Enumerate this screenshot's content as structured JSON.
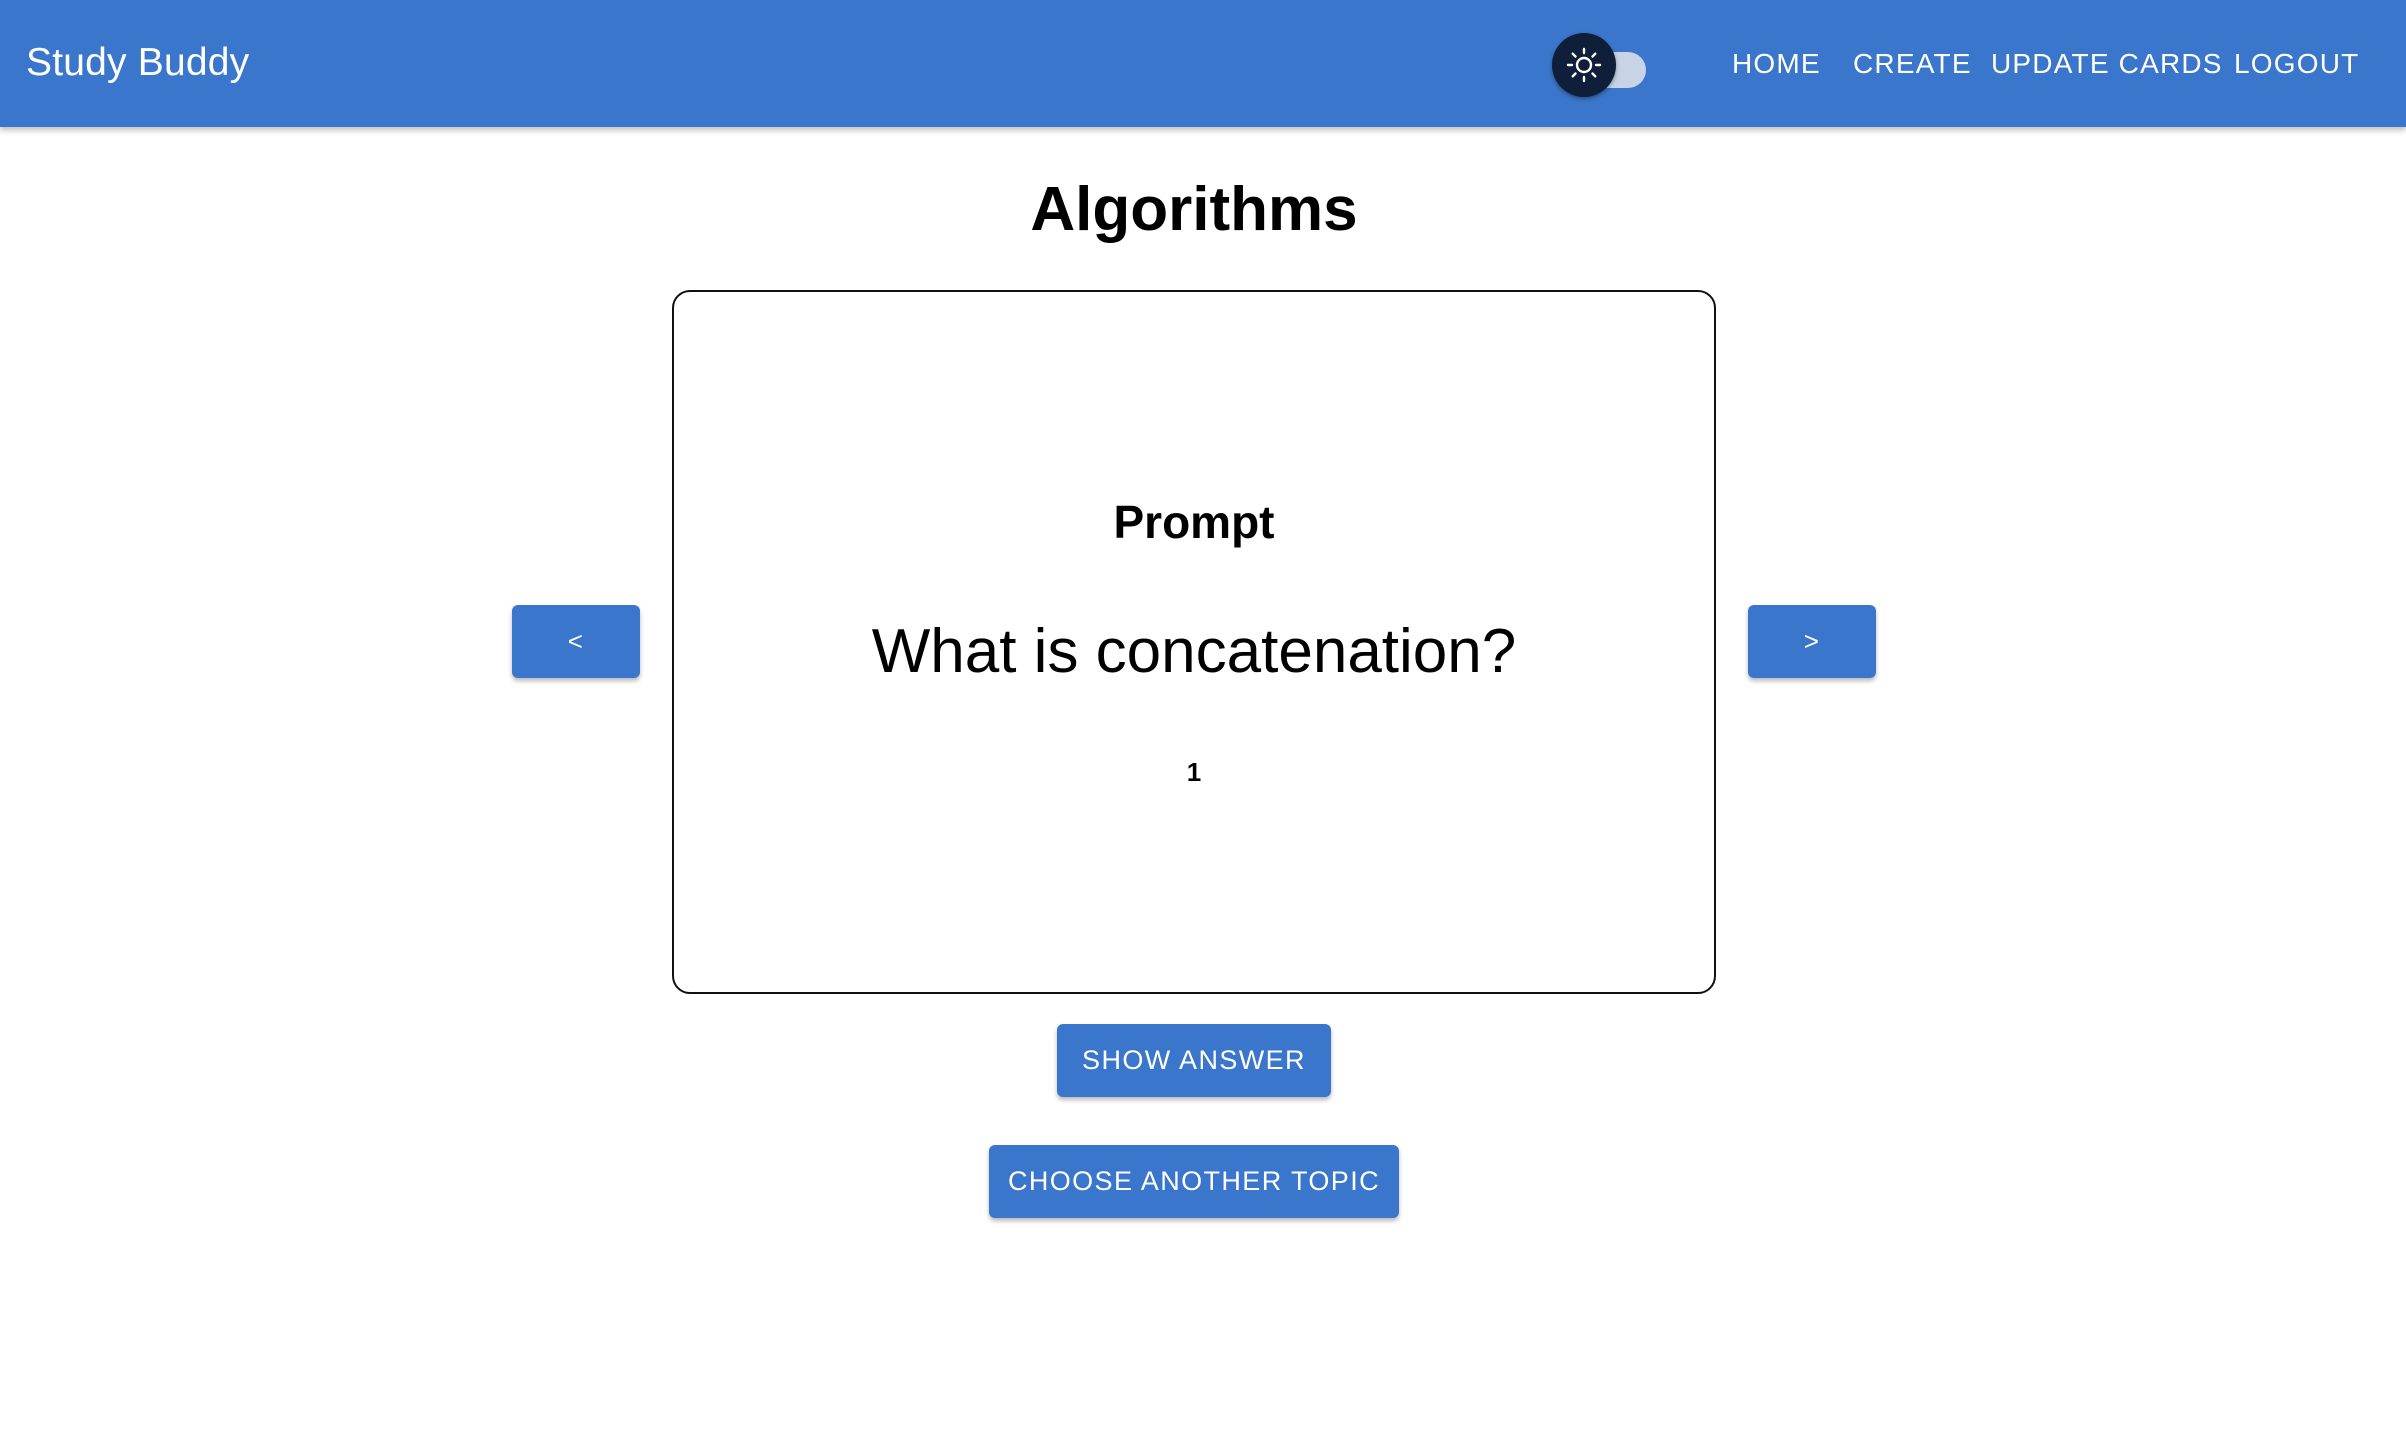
{
  "header": {
    "brand": "Study Buddy",
    "theme_toggle": {
      "icon": "sun-icon",
      "state": "light"
    },
    "nav": {
      "home": "HOME",
      "create": "CREATE",
      "update_cards": "UPDATE CARDS",
      "logout": "LOGOUT"
    }
  },
  "main": {
    "title": "Algorithms",
    "card": {
      "label": "Prompt",
      "text": "What is concatenation?",
      "number": "1"
    },
    "prev_label": "<",
    "next_label": ">",
    "show_answer_label": "SHOW ANSWER",
    "choose_topic_label": "CHOOSE ANOTHER TOPIC"
  },
  "colors": {
    "primary": "#3a76cc",
    "toggle_thumb": "#0f1f3a",
    "background": "#ffffff"
  }
}
